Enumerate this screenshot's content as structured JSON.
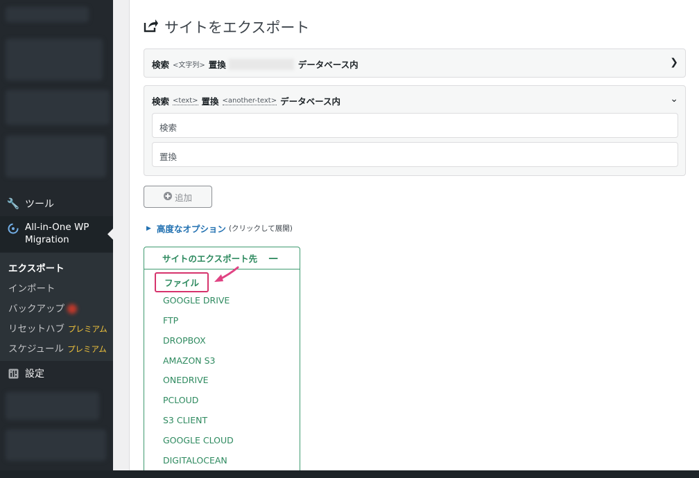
{
  "sidebar": {
    "tools_label": "ツール",
    "aio_label_line1": "All-in-One WP",
    "aio_label_line2": "Migration",
    "submenu": [
      {
        "label": "エクスポート",
        "premium": ""
      },
      {
        "label": "インポート",
        "premium": ""
      },
      {
        "label": "バックアップ",
        "premium": ""
      },
      {
        "label": "リセットハブ",
        "premium": "プレミアム"
      },
      {
        "label": "スケジュール",
        "premium": "プレミアム"
      }
    ],
    "settings_label": "設定"
  },
  "page": {
    "title": "サイトをエクスポート"
  },
  "replace_rows": [
    {
      "search": "検索",
      "search_tag": "<文字列>",
      "replace": "置換",
      "suffix": "データベース内"
    },
    {
      "search": "検索",
      "search_tag": "<text>",
      "replace": "置換",
      "replace_tag": "<another-text>",
      "suffix": "データベース内",
      "search_placeholder": "検索",
      "replace_placeholder": "置換"
    }
  ],
  "add_button": "追加",
  "advanced": {
    "link": "高度なオプション",
    "hint": "(クリックして展開)"
  },
  "export": {
    "header": "サイトのエクスポート先",
    "collapse": "—",
    "destinations": [
      "ファイル",
      "GOOGLE DRIVE",
      "FTP",
      "DROPBOX",
      "AMAZON S3",
      "ONEDRIVE",
      "PCLOUD",
      "S3 CLIENT",
      "GOOGLE CLOUD",
      "DIGITALOCEAN"
    ]
  },
  "colors": {
    "accent_green": "#2e8a5f",
    "highlight_pink": "#d6336c",
    "link_blue": "#2271b1",
    "sidebar_bg": "#23282d",
    "premium_yellow": "#f0c33c"
  }
}
